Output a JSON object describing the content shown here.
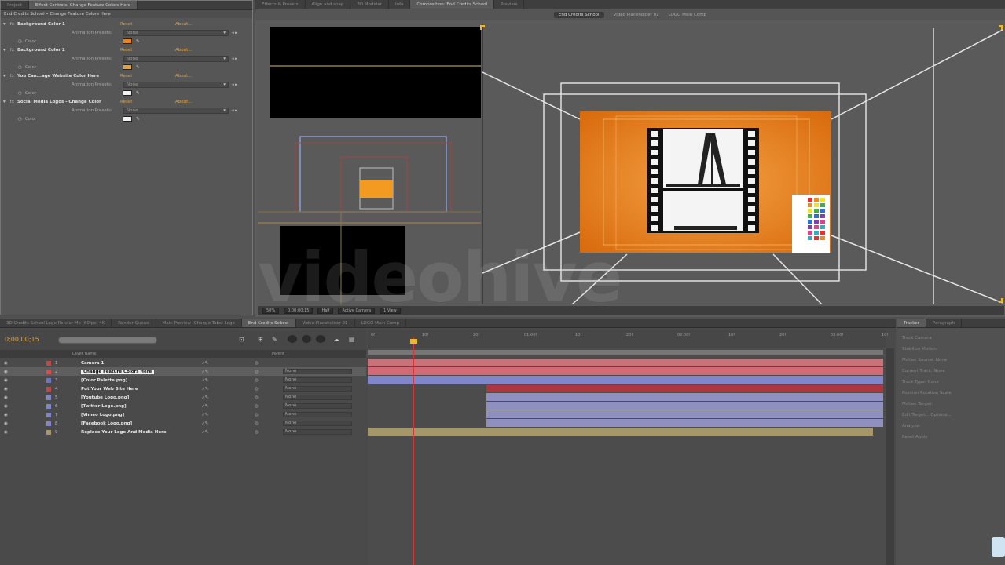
{
  "top_tabs_left": [
    {
      "label": "Project"
    },
    {
      "label": "Effect Controls: Change Feature Colors Here",
      "active": true
    }
  ],
  "top_tabs_right": [
    {
      "label": "Effects & Presets"
    },
    {
      "label": "Align and snap"
    },
    {
      "label": "3D Modeler"
    },
    {
      "label": "Info"
    },
    {
      "label": "Composition: End Credits School",
      "active": true
    },
    {
      "label": "Preview"
    }
  ],
  "ec": {
    "breadcrumb": "End Credits School • Change Feature Colors Here",
    "reset": "Reset",
    "about": "About...",
    "anim_label": "Animation Presets:",
    "anim_value": "None",
    "color_label": "Color",
    "effects": [
      {
        "name": "Background Color 1",
        "swatch": "#e8841a"
      },
      {
        "name": "Background Color 2",
        "swatch": "#f0a030"
      },
      {
        "name": "You Can...age Website Color Here",
        "swatch": "#f2f2f2"
      },
      {
        "name": "Social Media Logos - Change Color",
        "swatch": "#f2f2f2"
      }
    ]
  },
  "comp_subtabs": [
    {
      "label": "End Credits School",
      "active": true
    },
    {
      "label": "Video Placeholder 01"
    },
    {
      "label": "LOGO Main Comp"
    }
  ],
  "viewer_controls": {
    "zoom": "50%",
    "time": "0;00;00;15",
    "res": "Half",
    "camera": "Active Camera",
    "views": "1 View"
  },
  "timeline_tabs": [
    {
      "label": "3D Credits School Logo Render Me (60fps) 4K"
    },
    {
      "label": "Render Queue"
    },
    {
      "label": "Main Preview (Change Tabs) Logo"
    },
    {
      "label": "End Credits School",
      "active": true
    },
    {
      "label": "Video Placeholder 01"
    },
    {
      "label": "LOGO Main Comp"
    }
  ],
  "timecode": "0;00;00;15",
  "search_placeholder": "",
  "layer_header": {
    "name": "Layer Name",
    "parent": "Parent"
  },
  "ruler": [
    "0f",
    "10f",
    "20f",
    "01:00f",
    "10f",
    "20f",
    "02:00f",
    "10f",
    "20f",
    "03:00f",
    "10f"
  ],
  "layers": [
    {
      "num": "1",
      "name": "Camera 1",
      "color": "#c04848",
      "mode": ""
    },
    {
      "num": "2",
      "name": "Change Feature Colors Here",
      "color": "#d05050",
      "mode": "None",
      "selected": true
    },
    {
      "num": "3",
      "name": "[Color Palette.png]",
      "color": "#6a74c8",
      "mode": "None"
    },
    {
      "num": "4",
      "name": "Put Your Web Site Here",
      "color": "#c04848",
      "mode": "None"
    },
    {
      "num": "5",
      "name": "[Youtube Logo.png]",
      "color": "#7f86c9",
      "mode": "None"
    },
    {
      "num": "6",
      "name": "[Twitter Logo.png]",
      "color": "#7f86c9",
      "mode": "None"
    },
    {
      "num": "7",
      "name": "[Vimeo Logo.png]",
      "color": "#7f86c9",
      "mode": "None"
    },
    {
      "num": "8",
      "name": "[Facebook Logo.png]",
      "color": "#7f86c9",
      "mode": "None"
    },
    {
      "num": "9",
      "name": "Replace Your Logo And Media Here",
      "color": "#a6976a",
      "mode": "None"
    }
  ],
  "right_panel": {
    "tabs": [
      {
        "label": "Tracker",
        "active": true
      },
      {
        "label": "Paragraph"
      }
    ],
    "rows": [
      "Track Camera",
      "Stabilize Motion",
      "Motion Source: None",
      "Current Track: None",
      "Track Type: None",
      "Position  Rotation  Scale",
      "Motion Target:",
      "Edit Target...   Options...",
      "Analyze:",
      "Reset   Apply"
    ]
  },
  "watermark": "videohive"
}
